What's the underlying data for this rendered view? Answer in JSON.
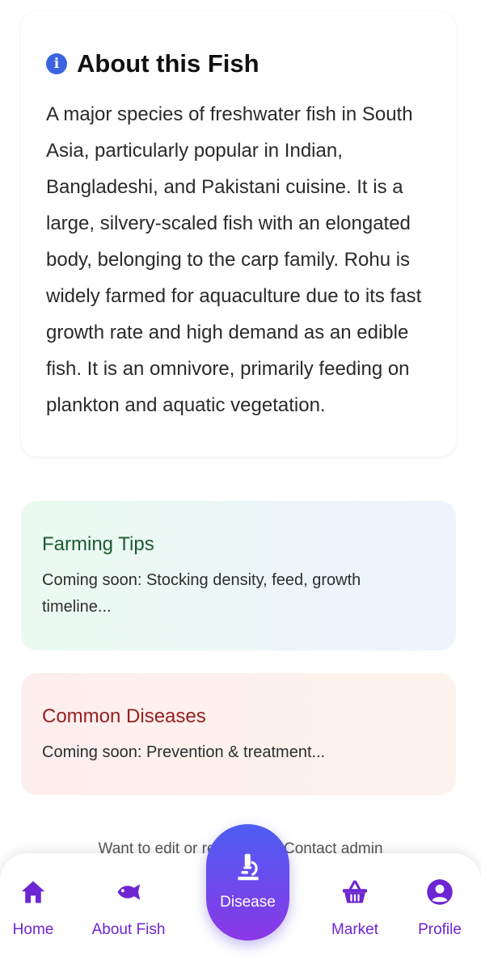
{
  "about": {
    "title": "About this Fish",
    "icon": "info-icon",
    "body": "A major species of freshwater fish in South Asia, particularly popular in Indian, Bangladeshi, and Pakistani cuisine. It is a large, silvery-scaled fish with an elongated body, belonging to the carp family. Rohu is widely farmed for aquaculture due to its fast growth rate and high demand as an edible fish. It is an omnivore, primarily feeding on plankton and aquatic vegetation."
  },
  "farming_tips": {
    "title": "Farming Tips",
    "text": "Coming soon: Stocking density, feed, growth timeline..."
  },
  "common_diseases": {
    "title": "Common Diseases",
    "text": "Coming soon: Prevention & treatment..."
  },
  "contact_note": "Want to edit or report info? Contact admin",
  "nav": {
    "home": "Home",
    "about_fish": "About Fish",
    "disease": "Disease",
    "market": "Market",
    "profile": "Profile"
  },
  "colors": {
    "accent": "#6d26d1",
    "info_blue": "#3b63e0",
    "fab_top": "#4d5ef2",
    "fab_bottom": "#8a37e6",
    "farming_title": "#1e5b30",
    "diseases_title": "#962020"
  }
}
